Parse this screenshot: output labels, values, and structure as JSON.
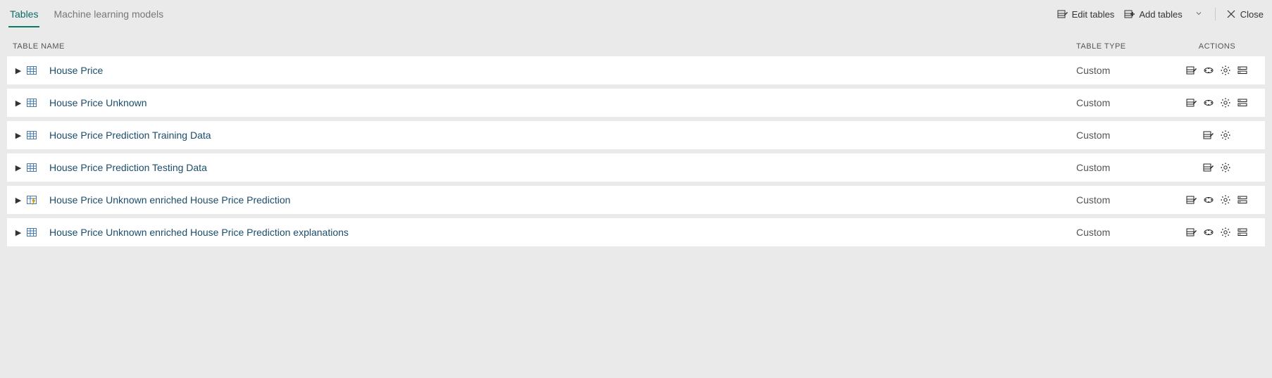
{
  "tabs": {
    "tables": "Tables",
    "ml": "Machine learning models"
  },
  "toolbar": {
    "edit": "Edit tables",
    "add": "Add tables",
    "close": "Close"
  },
  "headers": {
    "name": "Table Name",
    "type": "Table Type",
    "actions": "Actions"
  },
  "rows": [
    {
      "name": "House Price",
      "type": "Custom",
      "actions": [
        "edit",
        "ml",
        "settings",
        "data"
      ],
      "icon": "table"
    },
    {
      "name": "House Price Unknown",
      "type": "Custom",
      "actions": [
        "edit",
        "ml",
        "settings",
        "data"
      ],
      "icon": "table"
    },
    {
      "name": "House Price Prediction Training Data",
      "type": "Custom",
      "actions": [
        "edit",
        "settings"
      ],
      "icon": "table"
    },
    {
      "name": "House Price Prediction Testing Data",
      "type": "Custom",
      "actions": [
        "edit",
        "settings"
      ],
      "icon": "table"
    },
    {
      "name": "House Price Unknown enriched House Price Prediction",
      "type": "Custom",
      "actions": [
        "edit",
        "ml",
        "settings",
        "data"
      ],
      "icon": "table-lightning"
    },
    {
      "name": "House Price Unknown enriched House Price Prediction explanations",
      "type": "Custom",
      "actions": [
        "edit",
        "ml",
        "settings",
        "data"
      ],
      "icon": "table"
    }
  ]
}
